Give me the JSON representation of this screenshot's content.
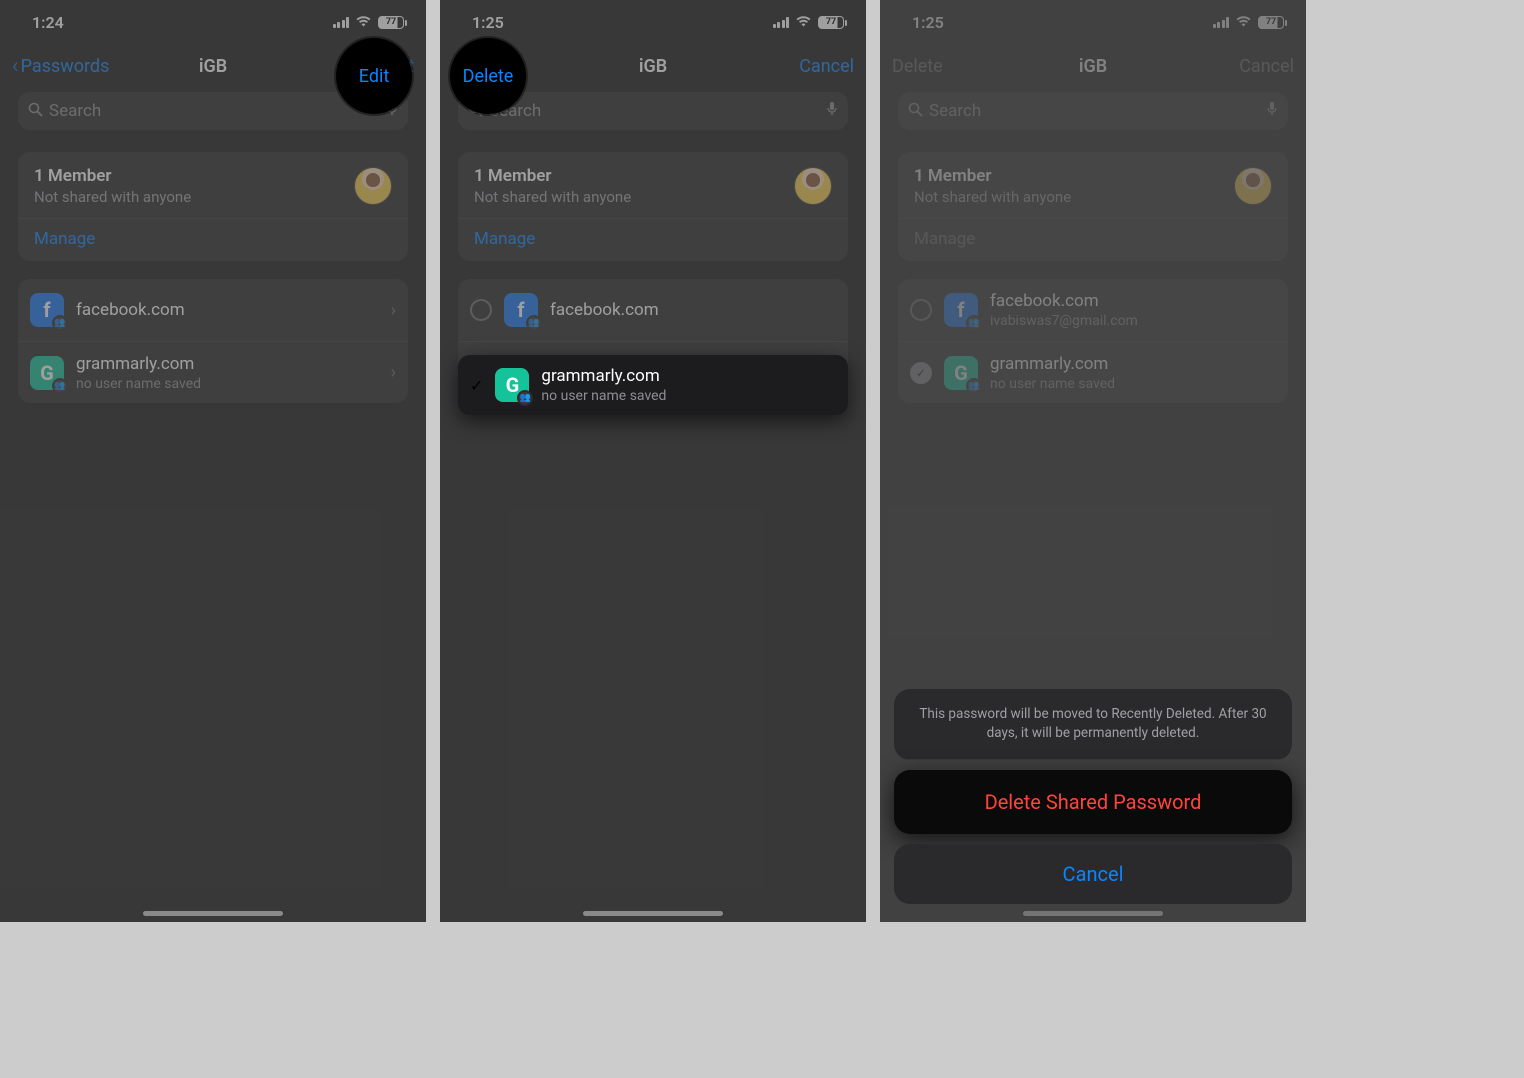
{
  "status": {
    "timeA": "1:24",
    "timeB": "1:25",
    "timeC": "1:25",
    "battery": "77"
  },
  "screen1": {
    "nav": {
      "back": "Passwords",
      "title": "iGB",
      "edit": "Edit"
    },
    "search": {
      "placeholder": "Search"
    },
    "member": {
      "title": "1 Member",
      "sub": "Not shared with anyone",
      "manage": "Manage"
    },
    "rows": {
      "r1": {
        "site": "facebook.com",
        "sub": ""
      },
      "r2": {
        "site": "grammarly.com",
        "sub": "no user name saved"
      }
    }
  },
  "screen2": {
    "nav": {
      "delete": "Delete",
      "title": "iGB",
      "cancel": "Cancel"
    },
    "search": {
      "placeholder": "Search"
    },
    "member": {
      "title": "1 Member",
      "sub": "Not shared with anyone",
      "manage": "Manage"
    },
    "rows": {
      "r1": {
        "site": "facebook.com",
        "sub": ""
      },
      "r2": {
        "site": "grammarly.com",
        "sub": "no user name saved"
      }
    }
  },
  "screen3": {
    "nav": {
      "delete": "Delete",
      "title": "iGB",
      "cancel": "Cancel"
    },
    "search": {
      "placeholder": "Search"
    },
    "member": {
      "title": "1 Member",
      "sub": "Not shared with anyone",
      "manage": "Manage"
    },
    "rows": {
      "r1": {
        "site": "facebook.com",
        "sub": "ivabiswas7@gmail.com"
      },
      "r2": {
        "site": "grammarly.com",
        "sub": "no user name saved"
      }
    },
    "sheet": {
      "msg": "This password will be moved to Recently Deleted. After 30 days, it will be permanently deleted.",
      "delete": "Delete Shared Password",
      "cancel": "Cancel"
    }
  }
}
